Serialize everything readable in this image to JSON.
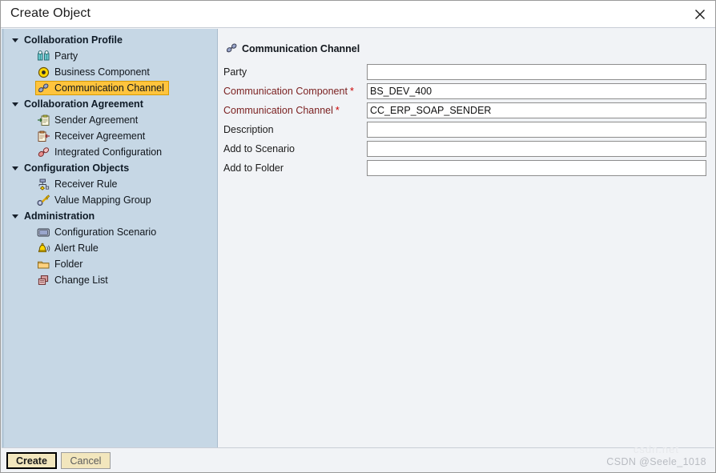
{
  "window": {
    "title": "Create Object",
    "close_icon": "close-icon"
  },
  "sidebar": {
    "groups": [
      {
        "label": "Collaboration Profile",
        "expanded": true,
        "items": [
          {
            "label": "Party",
            "icon": "party-icon",
            "selected": false
          },
          {
            "label": "Business Component",
            "icon": "business-component-icon",
            "selected": false
          },
          {
            "label": "Communication Channel",
            "icon": "communication-channel-icon",
            "selected": true
          }
        ]
      },
      {
        "label": "Collaboration Agreement",
        "expanded": true,
        "items": [
          {
            "label": "Sender Agreement",
            "icon": "sender-agreement-icon",
            "selected": false
          },
          {
            "label": "Receiver Agreement",
            "icon": "receiver-agreement-icon",
            "selected": false
          },
          {
            "label": "Integrated Configuration",
            "icon": "integrated-configuration-icon",
            "selected": false
          }
        ]
      },
      {
        "label": "Configuration Objects",
        "expanded": true,
        "items": [
          {
            "label": "Receiver Rule",
            "icon": "receiver-rule-icon",
            "selected": false
          },
          {
            "label": "Value Mapping Group",
            "icon": "value-mapping-group-icon",
            "selected": false
          }
        ]
      },
      {
        "label": "Administration",
        "expanded": true,
        "items": [
          {
            "label": "Configuration Scenario",
            "icon": "configuration-scenario-icon",
            "selected": false
          },
          {
            "label": "Alert Rule",
            "icon": "alert-rule-icon",
            "selected": false
          },
          {
            "label": "Folder",
            "icon": "folder-icon",
            "selected": false
          },
          {
            "label": "Change List",
            "icon": "change-list-icon",
            "selected": false
          }
        ]
      }
    ]
  },
  "panel": {
    "heading": "Communication Channel",
    "heading_icon": "communication-channel-icon",
    "fields": [
      {
        "label": "Party",
        "value": "",
        "required": false,
        "focused": false
      },
      {
        "label": "Communication Component",
        "value": "BS_DEV_400",
        "required": true,
        "focused": false
      },
      {
        "label": "Communication Channel",
        "value": "CC_ERP_SOAP_SENDER",
        "required": true,
        "focused": true
      },
      {
        "label": "Description",
        "value": "",
        "required": false,
        "focused": false
      },
      {
        "label": "Add to Scenario",
        "value": "",
        "required": false,
        "focused": false
      },
      {
        "label": "Add to Folder",
        "value": "",
        "required": false,
        "focused": false
      }
    ],
    "required_marker": "*"
  },
  "footer": {
    "create_label": "Create",
    "cancel_label": "Cancel",
    "watermark": "CSDN @Seele_1018",
    "watermark_ghost": "csdn.net"
  },
  "colors": {
    "sidebar_bg": "#c6d7e5",
    "content_bg": "#f1f3f6",
    "selection": "#ffc43d",
    "required_label": "#7a1f1f",
    "asterisk": "#cc0000",
    "button_face": "#f2e6bd"
  }
}
